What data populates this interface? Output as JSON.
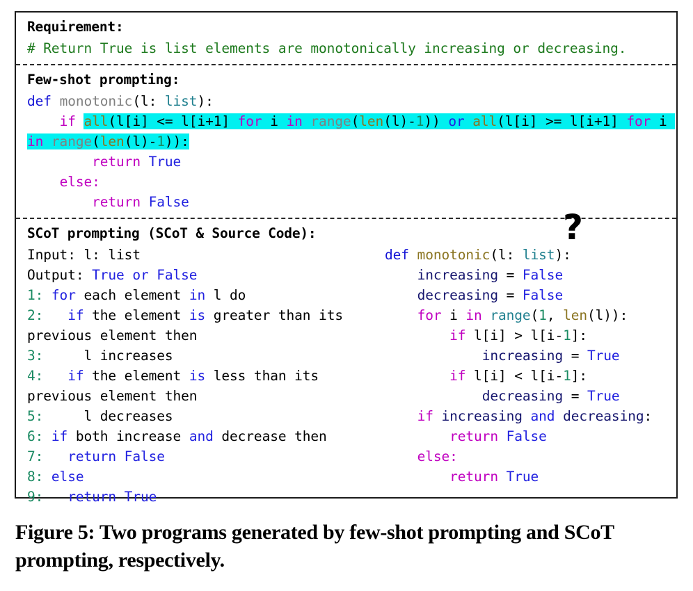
{
  "figure": {
    "caption": "Figure 5: Two programs generated by few-shot prompting and SCoT prompting, respectively.",
    "qmark": "?"
  },
  "sections": {
    "requirement": {
      "header": "Requirement:",
      "comment": "# Return True is list elements are monotonically increasing or decreasing."
    },
    "fewshot": {
      "header": "Few-shot prompting:",
      "code_tokens": {
        "def": "def",
        "fn_name": "monotonic",
        "paren_open": "(",
        "param": "l: ",
        "type": "list",
        "paren_close": "):",
        "if": "if",
        "all": "all",
        "expr1": "(l[i] <= l[i+1] ",
        "for": "for",
        "i": " i ",
        "in": "in",
        "range": " range",
        "len_open": "(",
        "len": "len",
        "len_args": "(l)-",
        "one": "1",
        "close2": "))",
        "or": "or",
        "all2": "all",
        "expr2": "(l[i] >= l[i+1] ",
        "for2": "for",
        "i2": " i ",
        "in2": "in",
        "range2": " range",
        "len_open2": "(",
        "len2": "len",
        "len_args2": "(l)-",
        "one2": "1",
        "close3": ")):",
        "return": "return",
        "true": "True",
        "else": "else:",
        "return2": "return",
        "false": "False"
      }
    },
    "scot": {
      "header": "SCoT prompting (SCoT & Source Code):",
      "pseudocode": {
        "input_label": "Input: l: list",
        "output_label": "Output: ",
        "output_value": "True or False",
        "lines": [
          {
            "num": "1:",
            "indent": " ",
            "kw": "for",
            "rest": " each element ",
            "kw2": "in",
            "rest2": " l do"
          },
          {
            "num": "2:",
            "indent": "   ",
            "kw": "if",
            "rest": " the element ",
            "kw2": "is",
            "rest2": " greater than its previous element then"
          },
          {
            "num": "3:",
            "indent": "     ",
            "kw": "",
            "rest": "l increases",
            "kw2": "",
            "rest2": ""
          },
          {
            "num": "4:",
            "indent": "   ",
            "kw": "if",
            "rest": " the element ",
            "kw2": "is",
            "rest2": " less than its previous element then"
          },
          {
            "num": "5:",
            "indent": "     ",
            "kw": "",
            "rest": "l decreases",
            "kw2": "",
            "rest2": ""
          },
          {
            "num": "6:",
            "indent": " ",
            "kw": "if",
            "rest": " both increase ",
            "kw2": "and",
            "rest2": " decrease then"
          },
          {
            "num": "7:",
            "indent": "   ",
            "kw": "return False",
            "rest": "",
            "kw2": "",
            "rest2": ""
          },
          {
            "num": "8:",
            "indent": " ",
            "kw": "else",
            "rest": "",
            "kw2": "",
            "rest2": ""
          },
          {
            "num": "9:",
            "indent": "   ",
            "kw": "return True",
            "rest": "",
            "kw2": "",
            "rest2": ""
          }
        ]
      },
      "source_code": {
        "def": "def",
        "fn_name": " monotonic",
        "sig_rest": "(l: ",
        "type": "list",
        "sig_close": "):",
        "var_increasing": "increasing",
        "assign": " = ",
        "false1": "False",
        "var_decreasing": "decreasing",
        "false2": "False",
        "for": "for",
        "for_i": " i ",
        "in": "in",
        "range": " range",
        "range_open": "(",
        "num1": "1",
        "comma": ", ",
        "len": "len",
        "len_rest": "(l)):",
        "if1": "if",
        "cond1_a": " l[i] > l[i-",
        "cond1_num": "1",
        "cond1_b": "]:",
        "inc_assign": "increasing",
        "true1": "True",
        "if2": "if",
        "cond2_a": " l[i] < l[i-",
        "cond2_num": "1",
        "cond2_b": "]:",
        "dec_assign": "decreasing",
        "true2": "True",
        "if3": "if",
        "if3_var1": " increasing ",
        "and": "and",
        "if3_var2": " decreasing",
        "if3_colon": ":",
        "return1": "return",
        "false3": "False",
        "else": "else:",
        "return2": "return",
        "true3": "True"
      }
    }
  }
}
